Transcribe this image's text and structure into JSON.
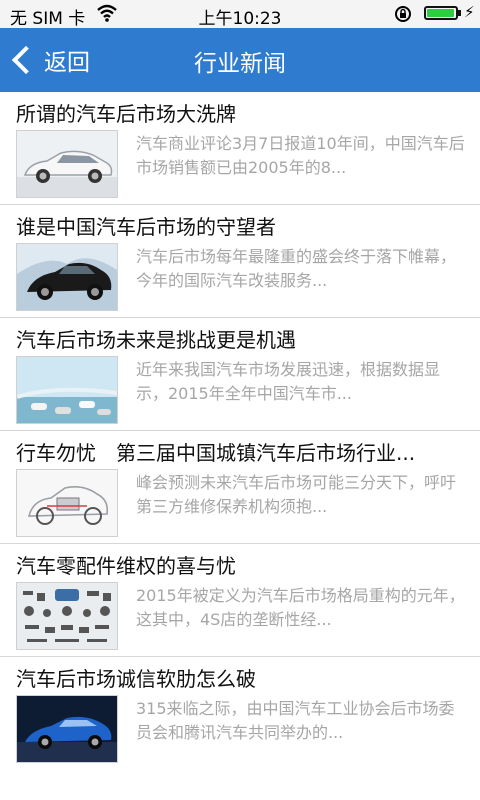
{
  "statusbar": {
    "carrier": "无 SIM 卡",
    "wifi_icon": "wifi-icon",
    "time": "上午10:23",
    "lock_icon": "rotation-lock-icon",
    "battery_level": 0.95
  },
  "navbar": {
    "back_label": "返回",
    "title": "行业新闻",
    "color": "#2e7bd0"
  },
  "news": [
    {
      "title": "所谓的汽车后市场大洗牌",
      "summary": "汽车商业评论3月7日报道10年间，中国汽车后市场销售额已由2005年的8..."
    },
    {
      "title": "谁是中国汽车后市场的守望者",
      "summary": "汽车后市场每年最隆重的盛会终于落下帷幕，今年的国际汽车改装服务..."
    },
    {
      "title": "汽车后市场未来是挑战更是机遇",
      "summary": "近年来我国汽车市场发展迅速，根据数据显示，2015年全年中国汽车市..."
    },
    {
      "title": "行车勿忧　第三届中国城镇汽车后市场行业...",
      "summary": "峰会预测未来汽车后市场可能三分天下，呼吁第三方维修保养机构须抱..."
    },
    {
      "title": "汽车零配件维权的喜与忧",
      "summary": "2015年被定义为汽车后市场格局重构的元年，这其中，4S店的垄断性经..."
    },
    {
      "title": "汽车后市场诚信软肋怎么破",
      "summary": "315来临之际，由中国汽车工业协会后市场委员会和腾讯汽车共同举办的..."
    }
  ]
}
